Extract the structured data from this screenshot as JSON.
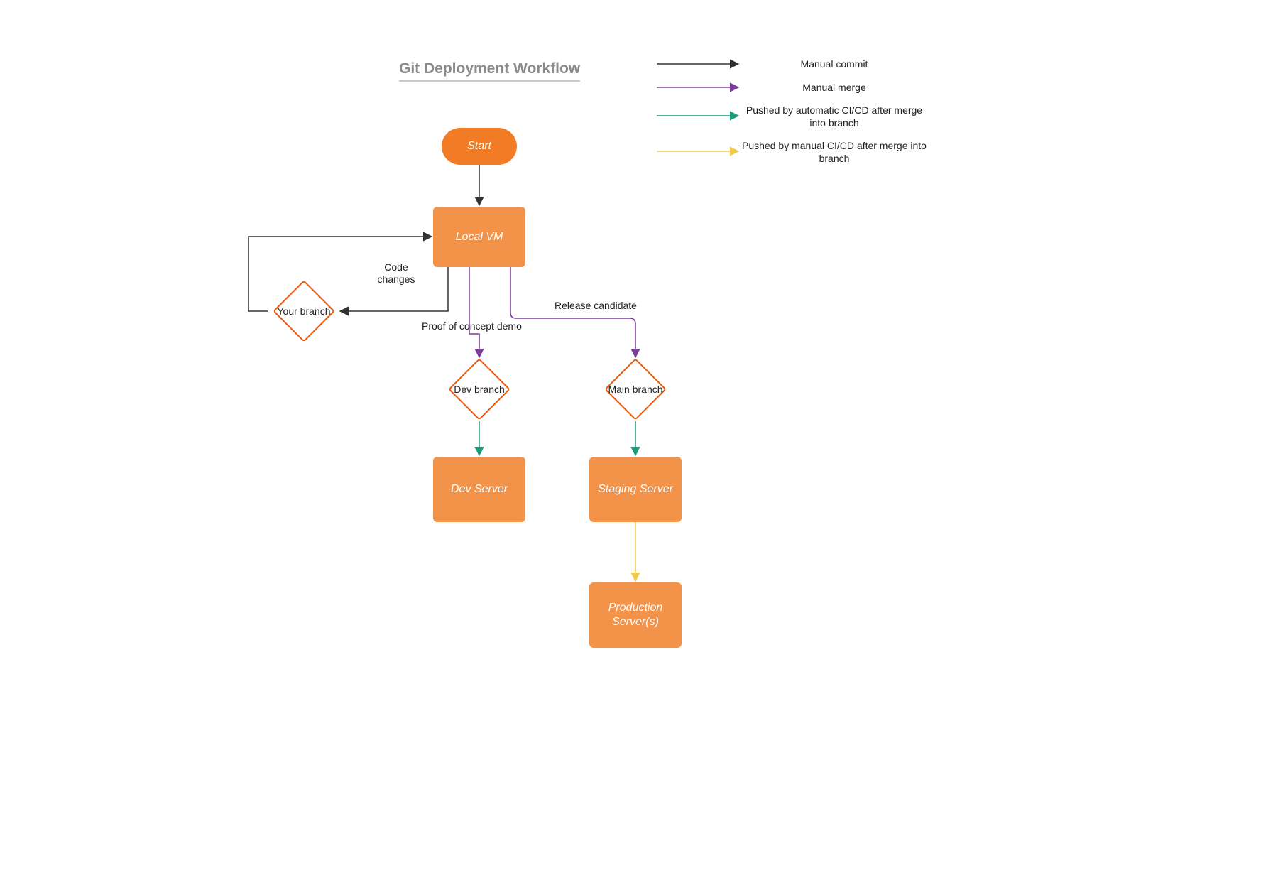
{
  "title": "Git Deployment Workflow",
  "nodes": {
    "start": "Start",
    "local_vm": "Local VM",
    "your_branch": "Your branch",
    "dev_branch": "Dev branch",
    "main_branch": "Main branch",
    "dev_server": "Dev Server",
    "staging_server": "Staging Server",
    "production": "Production Server(s)"
  },
  "edge_labels": {
    "code_changes": "Code changes",
    "proof_of_concept": "Proof of concept demo",
    "release_candidate": "Release candidate"
  },
  "legend": {
    "manual_commit": "Manual commit",
    "manual_merge": "Manual merge",
    "auto_cicd": "Pushed by automatic CI/CD after merge into branch",
    "manual_cicd": "Pushed by manual CI/CD after merge into branch"
  },
  "colors": {
    "commit": "#333333",
    "merge": "#7a3b9b",
    "auto": "#1d9b7b",
    "manual": "#f2c94c",
    "node_fill_dark": "#f27c25",
    "node_fill": "#f3934a",
    "node_stroke": "#ea5a0b"
  }
}
